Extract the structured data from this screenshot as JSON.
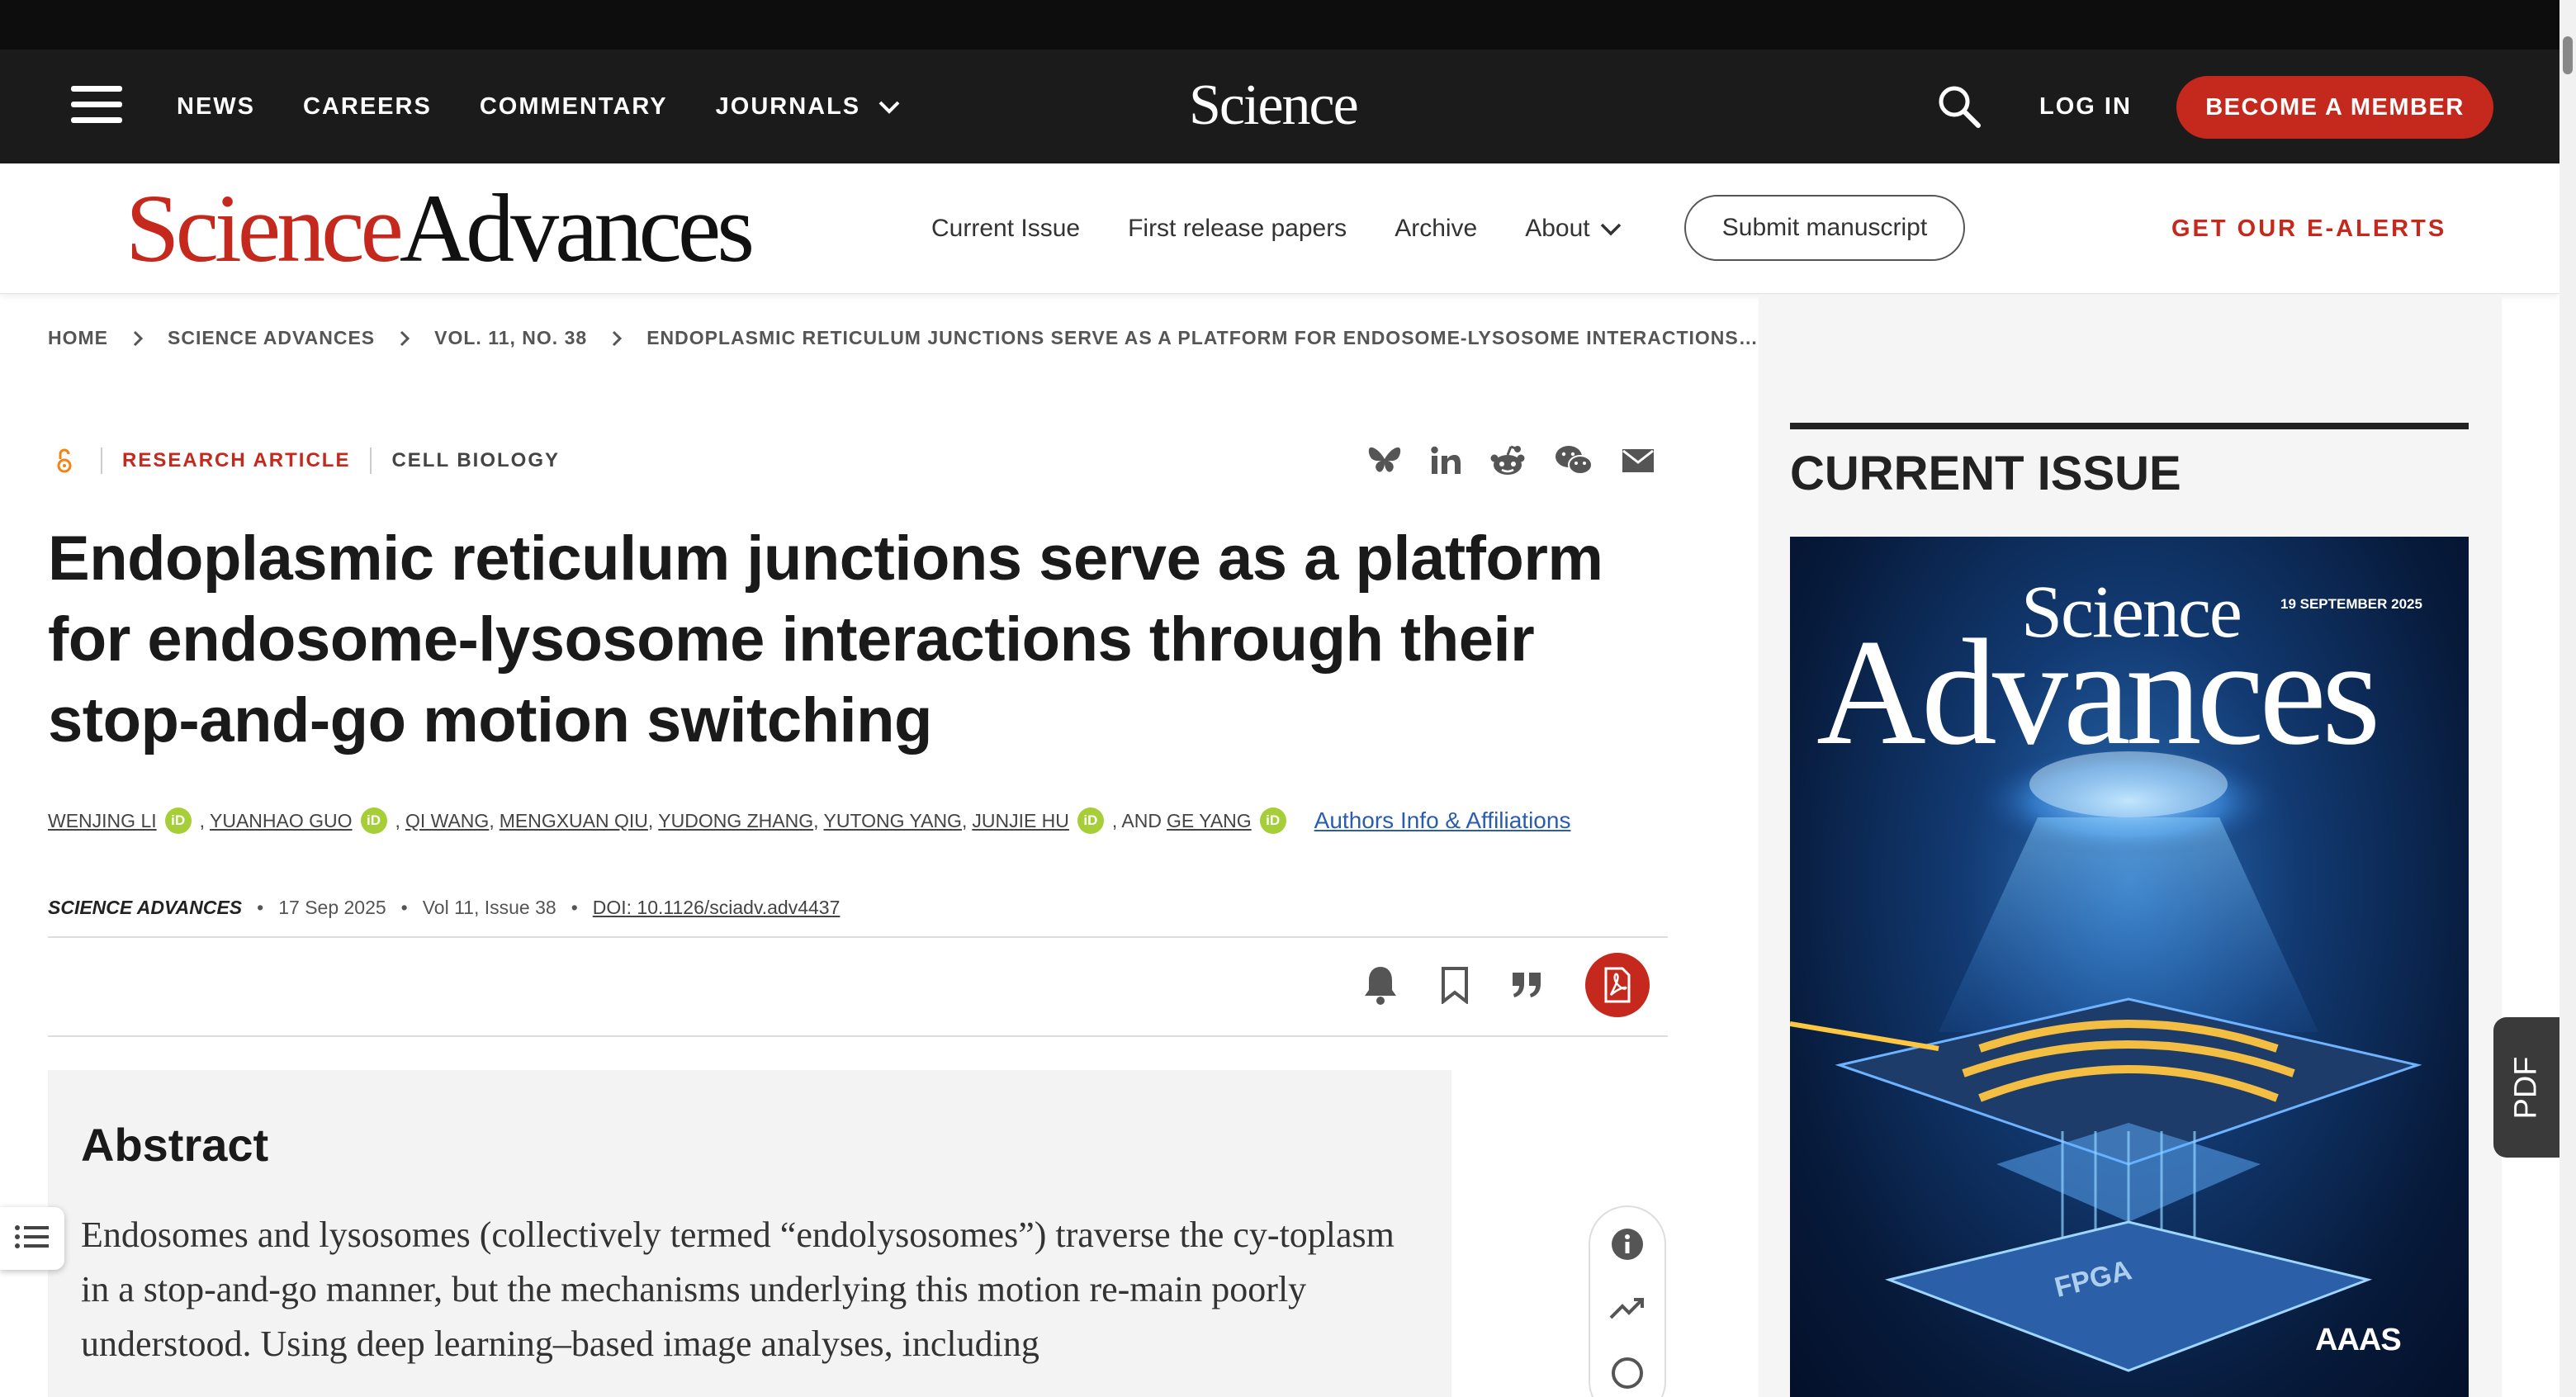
{
  "topnav": {
    "items": [
      {
        "label": "NEWS"
      },
      {
        "label": "CAREERS"
      },
      {
        "label": "COMMENTARY"
      },
      {
        "label": "JOURNALS"
      }
    ],
    "logo": "Science",
    "login": "LOG IN",
    "member": "BECOME A MEMBER"
  },
  "journal": {
    "logo_science": "Science",
    "logo_advances": "Advances",
    "nav": [
      {
        "label": "Current Issue"
      },
      {
        "label": "First release papers"
      },
      {
        "label": "Archive"
      },
      {
        "label": "About"
      }
    ],
    "submit": "Submit manuscript",
    "alerts": "GET OUR E-ALERTS"
  },
  "breadcrumb": [
    "HOME",
    "SCIENCE ADVANCES",
    "VOL. 11, NO. 38",
    "ENDOPLASMIC RETICULUM JUNCTIONS SERVE AS A PLATFORM FOR ENDOSOME-LYSOSOME INTERACTIONS…"
  ],
  "article": {
    "type": "RESEARCH ARTICLE",
    "subject": "CELL BIOLOGY",
    "title": "Endoplasmic reticulum junctions serve as a platform for endosome-lysosome interactions through their stop-and-go motion switching",
    "authors": [
      "WENJING LI",
      "YUANHAO GUO",
      "QI WANG",
      "MENGXUAN QIU",
      "YUDONG ZHANG",
      "YUTONG YANG",
      "JUNJIE HU",
      "GE YANG"
    ],
    "and_text": ", AND",
    "orcid_label": "iD",
    "affiliations": "Authors Info & Affiliations",
    "journal": "SCIENCE ADVANCES",
    "date": "17 Sep 2025",
    "issue": "Vol 11, Issue 38",
    "doi": "DOI: 10.1126/sciadv.adv4437",
    "bullet": "•"
  },
  "abstract": {
    "heading": "Abstract",
    "text": "Endosomes and lysosomes (collectively termed “endolysosomes”) traverse the cy-toplasm in a stop-and-go manner, but the mechanisms underlying this motion re-main poorly understood. Using deep learning–based image analyses, including"
  },
  "sidebar": {
    "heading": "CURRENT ISSUE",
    "cover": {
      "science": "Science",
      "advances": "Advances",
      "date": "19 SEPTEMBER 2025",
      "aaas": "AAAS",
      "chip": "FPGA"
    }
  },
  "pdf_tab": "PDF",
  "colors": {
    "brand_red": "#c5281c",
    "topbar": "#1b1b1b",
    "orcid": "#a6ce39",
    "link": "#2a5db0"
  }
}
